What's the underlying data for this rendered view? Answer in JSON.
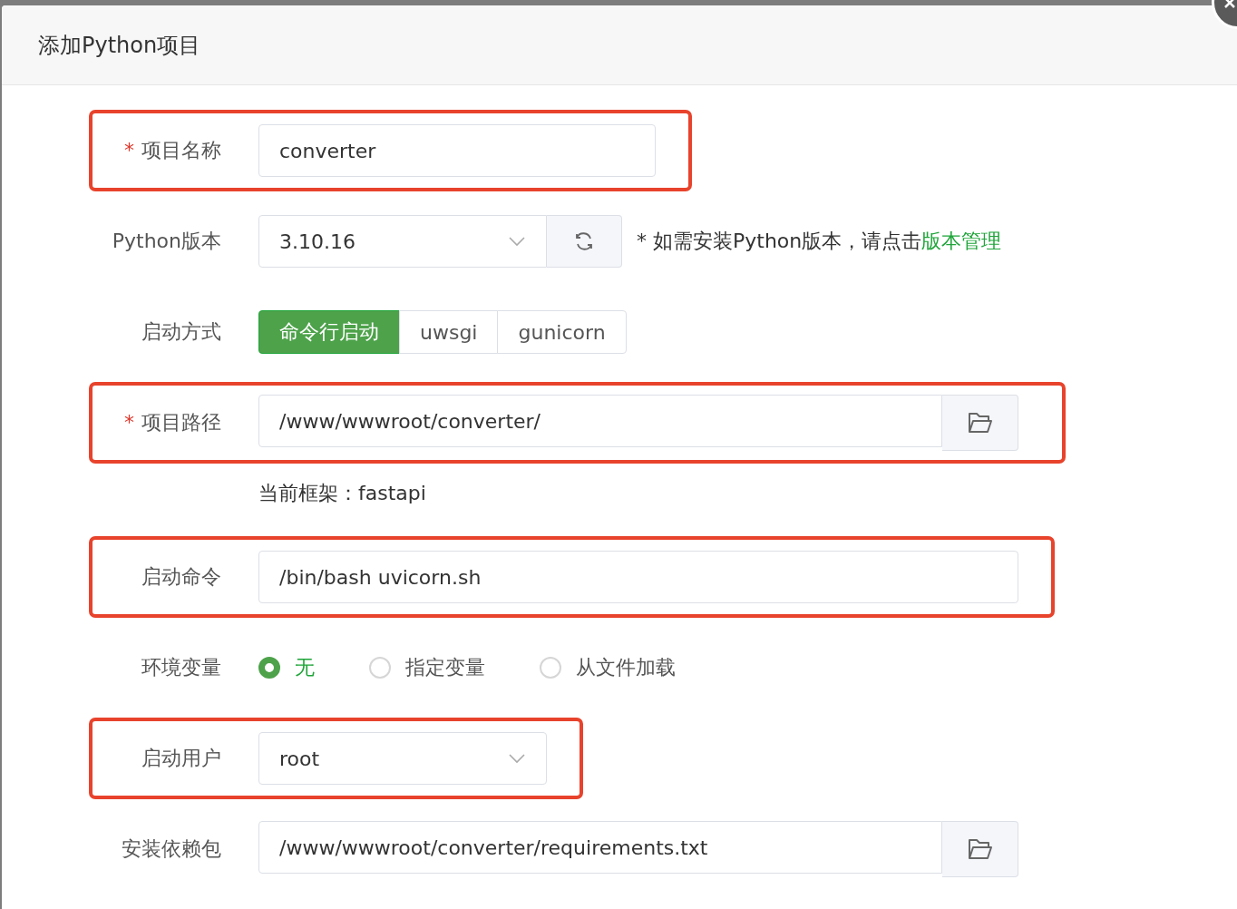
{
  "dialog": {
    "title": "添加Python项目"
  },
  "fields": [
    {
      "kind": "short_text",
      "label": "项目名称",
      "mark": "*",
      "highlighted": true,
      "value": "converter"
    },
    {
      "kind": "version",
      "label": "Python版本",
      "highlighted": false,
      "value": "3.10.16",
      "hint": "* 如需安装Python版本，请点击",
      "link": "版本管理"
    },
    {
      "kind": "segmented",
      "label": "启动方式",
      "highlighted": false,
      "options": [
        {
          "label": "命令行启动",
          "selected": true
        },
        {
          "label": "uwsgi",
          "selected": false
        },
        {
          "label": "gunicorn",
          "selected": false
        }
      ]
    },
    {
      "kind": "path",
      "label": "项目路径",
      "mark": "*",
      "highlighted": true,
      "value": "/www/wwwroot/converter/"
    },
    {
      "kind": "note",
      "text": "当前框架：fastapi"
    },
    {
      "kind": "text",
      "label": "启动命令",
      "highlighted": true,
      "value": "/bin/bash uvicorn.sh"
    },
    {
      "kind": "radio",
      "label": "环境变量",
      "highlighted": false,
      "options": [
        {
          "label": "无",
          "selected": true
        },
        {
          "label": "指定变量",
          "selected": false
        },
        {
          "label": "从文件加载",
          "selected": false
        }
      ]
    },
    {
      "kind": "select",
      "label": "启动用户",
      "highlighted": true,
      "value": "root"
    },
    {
      "kind": "path",
      "label": "安装依赖包",
      "highlighted": false,
      "value": "/www/wwwroot/converter/requirements.txt"
    }
  ]
}
